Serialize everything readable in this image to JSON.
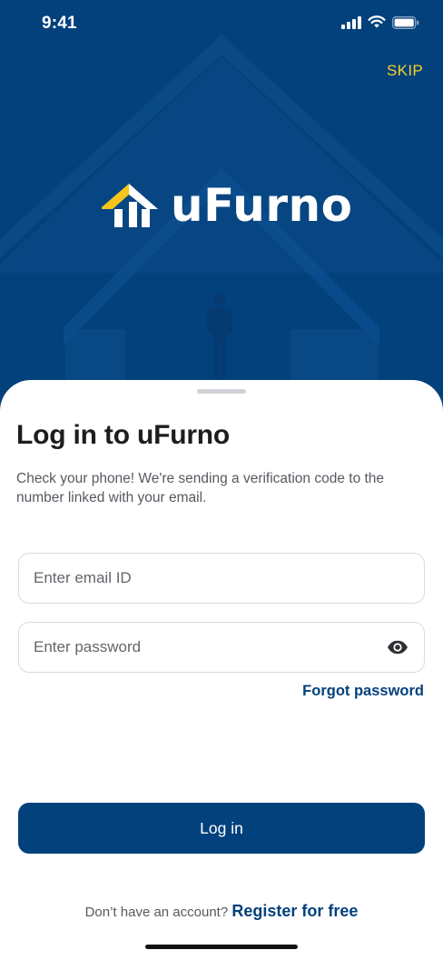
{
  "status_bar": {
    "time": "9:41",
    "icons": [
      "signal-icon",
      "wifi-icon",
      "battery-icon"
    ]
  },
  "hero": {
    "skip_label": "SKIP",
    "brand_name": "uFurno",
    "logo_icon": "house-logo-icon"
  },
  "login": {
    "title": "Log in to uFurno",
    "subtitle": "Check your phone! We're sending a verification code to the number linked with your email.",
    "email_placeholder": "Enter email ID",
    "password_placeholder": "Enter password",
    "password_toggle_icon": "eye-icon",
    "forgot_label": "Forgot password",
    "login_label": "Log in",
    "register_prompt": "Don’t have an account?",
    "register_label": "Register for free"
  },
  "colors": {
    "primary": "#03417c",
    "accent": "#f4d128",
    "background": "#ffffff",
    "input_border": "#d9dbde"
  }
}
